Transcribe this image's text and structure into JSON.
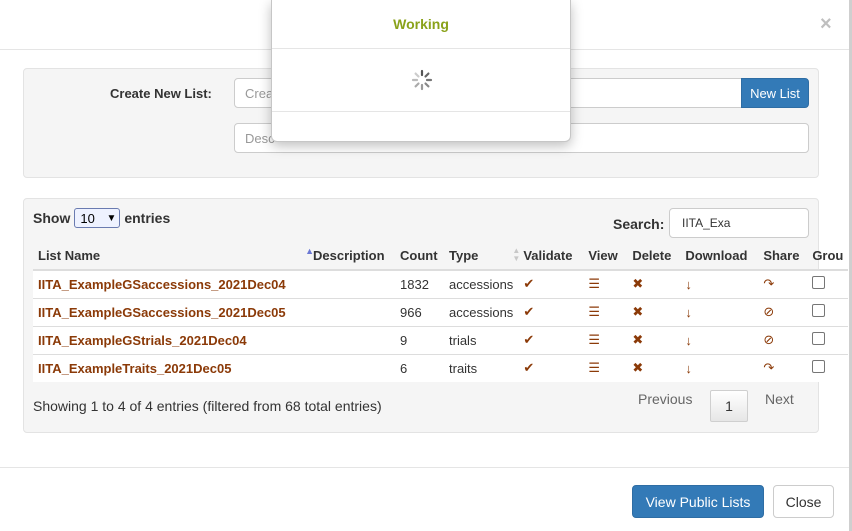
{
  "dialog": {
    "close_glyph": "×"
  },
  "create": {
    "label": "Create New List:",
    "name_placeholder": "Create",
    "desc_placeholder": "Desc",
    "button_label": "New List"
  },
  "table_controls": {
    "show_label": "Show",
    "entries_value": "10",
    "entries_label": "entries",
    "search_label": "Search:",
    "search_value": "IITA_Exa"
  },
  "table": {
    "headers": [
      "List Name",
      "Description",
      "Count",
      "Type",
      "Validate",
      "View",
      "Delete",
      "Download",
      "Share",
      "Grou"
    ],
    "rows": [
      {
        "name": "IITA_ExampleGSaccessions_2021Dec04",
        "description": "",
        "count": "1832",
        "type": "accessions",
        "share": "share-arrow-icon"
      },
      {
        "name": "IITA_ExampleGSaccessions_2021Dec05",
        "description": "",
        "count": "966",
        "type": "accessions",
        "share": "ban-icon"
      },
      {
        "name": "IITA_ExampleGStrials_2021Dec04",
        "description": "",
        "count": "9",
        "type": "trials",
        "share": "ban-icon"
      },
      {
        "name": "IITA_ExampleTraits_2021Dec05",
        "description": "",
        "count": "6",
        "type": "traits",
        "share": "share-arrow-icon"
      }
    ],
    "icons": {
      "validate": "✔",
      "view": "☰",
      "delete": "✖",
      "download": "↓",
      "share_arrow": "↷",
      "ban": "⊘"
    }
  },
  "pagination": {
    "info": "Showing 1 to 4 of 4 entries (filtered from 68 total entries)",
    "previous": "Previous",
    "page": "1",
    "next": "Next"
  },
  "footer": {
    "view_public_label": "View Public Lists",
    "close_label": "Close"
  },
  "working_modal": {
    "title": "Working"
  },
  "colors": {
    "primary": "#337ab7",
    "list_name": "#8b3a08",
    "working_title": "#8aa21a"
  }
}
